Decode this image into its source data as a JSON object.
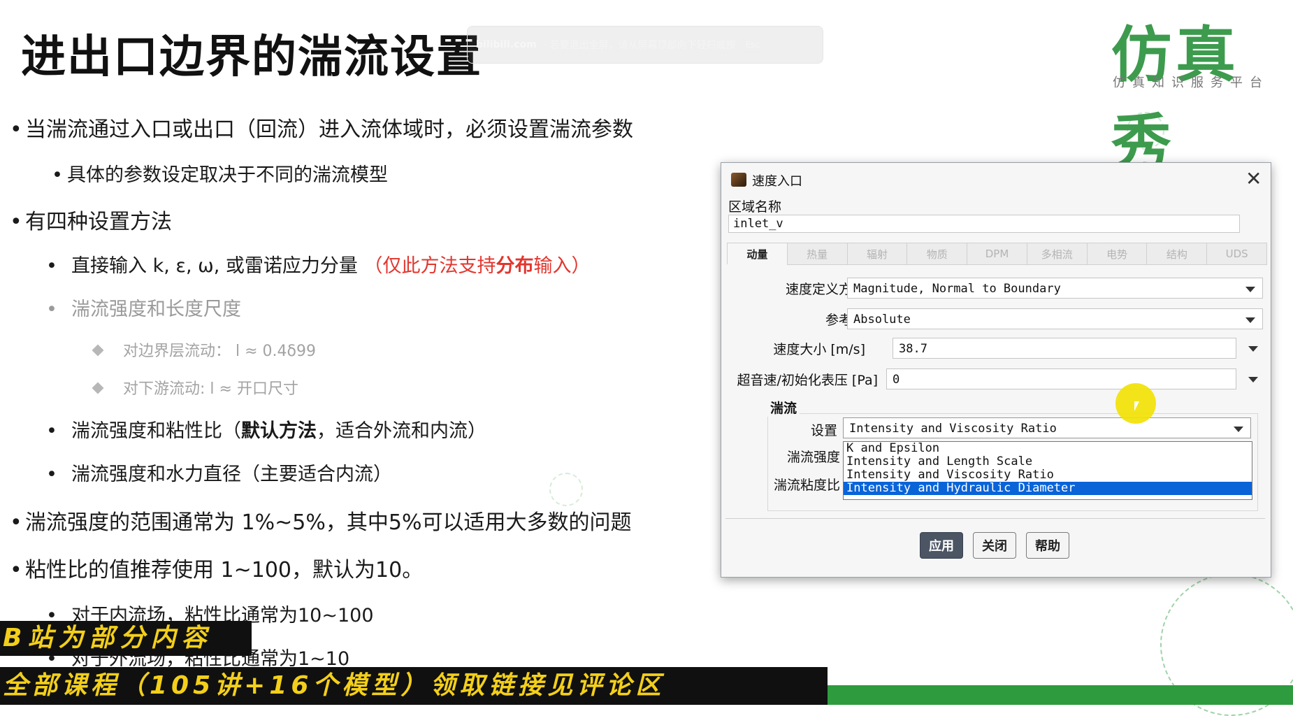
{
  "slide": {
    "title": "进出口边界的湍流设置",
    "bilibili": {
      "brand": "bilibili.com",
      "notice": "· 若要退出全屏，请从屏幕顶部向下轻扫或按",
      "esc": "Esc"
    },
    "logo": {
      "name": "仿真秀",
      "subtitle": "仿真知识服务平台"
    },
    "bullets": {
      "b1": "当湍流通过入口或出口（回流）进入流体域时，必须设置湍流参数",
      "b1_1": "具体的参数设定取决于不同的湍流模型",
      "b2": "有四种设置方法",
      "b2_1_text": "直接输入 k, ε, ω, 或雷诺应力分量",
      "b2_1_red_a": "（仅此方法支持",
      "b2_1_red_bold": "分布",
      "b2_1_red_b": "输入）",
      "b2_2": "湍流强度和长度尺度",
      "b2_2_1": "对边界层流动：  l ≈ 0.4δ99",
      "b2_2_2": "对下游流动:    l ≈ 开口尺寸",
      "b2_3_a": "湍流强度和粘性比（",
      "b2_3_bold": "默认方法",
      "b2_3_b": "，适合外流和内流）",
      "b2_4": "湍流强度和水力直径（主要适合内流）",
      "b3": "湍流强度的范围通常为 1%~5%，其中5%可以适用大多数的问题",
      "b4": "粘性比的值推荐使用 1~100，默认为10。",
      "b4_1": "对于内流场，粘性比通常为10~100",
      "b4_2": "对于外流场，粘性比通常为1~10"
    },
    "banners": {
      "top": "B站为部分内容",
      "bottom": "全部课程（105讲+16个模型）领取链接见评论区"
    }
  },
  "dialog": {
    "title": "速度入口",
    "zone_label": "区域名称",
    "zone_value": "inlet_v",
    "tabs": [
      "动量",
      "热量",
      "辐射",
      "物质",
      "DPM",
      "多相流",
      "电势",
      "结构",
      "UDS"
    ],
    "fields": {
      "velocity_method_label": "速度定义方法",
      "velocity_method_value": "Magnitude, Normal to Boundary",
      "reference_frame_label": "参考系",
      "reference_frame_value": "Absolute",
      "velocity_mag_label": "速度大小 [m/s]",
      "velocity_mag_value": "38.7",
      "pressure_label": "超音速/初始化表压 [Pa]",
      "pressure_value": "0"
    },
    "turbulence": {
      "group_title": "湍流",
      "setting_label": "设置",
      "setting_value": "Intensity and Viscosity Ratio",
      "intensity_label": "湍流强度",
      "viscosity_label": "湍流粘度比",
      "options": [
        "K and Epsilon",
        "Intensity and Length Scale",
        "Intensity and Viscosity Ratio",
        "Intensity and Hydraulic Diameter"
      ],
      "highlighted_option": "Intensity and Hydraulic Diameter"
    },
    "buttons": {
      "apply": "应用",
      "close": "关闭",
      "help": "帮助"
    }
  },
  "colors": {
    "accent_red": "#e2362e",
    "logo_green": "#3d9b4e",
    "banner_yellow": "#f3cf1a",
    "selection_blue": "#0a64d8"
  }
}
